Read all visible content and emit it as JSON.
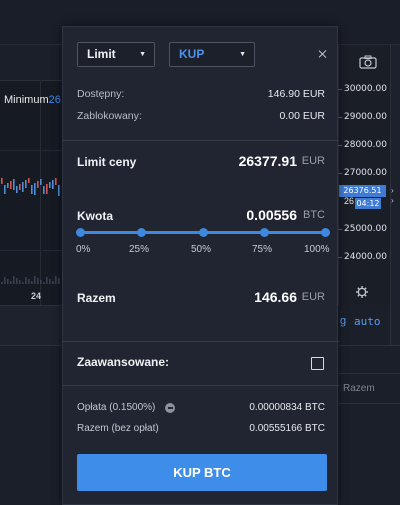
{
  "background": {
    "minimum_label": "Minimum",
    "minimum_value": "26",
    "x_tick": "24",
    "price_axis": [
      "30000.00",
      "29000.00",
      "28000.00",
      "27000.00",
      "26",
      "25000.00",
      "24000.00"
    ],
    "current_price": "26376.51",
    "countdown": "04:12",
    "auto_label": "auto",
    "g_label": "g",
    "razem_label": "Razem",
    "accent_color": "#3e7bd4"
  },
  "modal": {
    "order_type": "Limit",
    "side": "KUP",
    "available_label": "Dostępny:",
    "available_value": "146.90 EUR",
    "blocked_label": "Zablokowany:",
    "blocked_value": "0.00 EUR",
    "limit_label": "Limit ceny",
    "limit_value": "26377.91",
    "limit_unit": "EUR",
    "amount_label": "Kwota",
    "amount_value": "0.00556",
    "amount_unit": "BTC",
    "slider": {
      "fill_fraction": 1.0,
      "marks": [
        "0%",
        "25%",
        "50%",
        "75%",
        "100%"
      ]
    },
    "total_label": "Razem",
    "total_value": "146.66",
    "total_unit": "EUR",
    "advanced_label": "Zaawansowane:",
    "advanced_checked": false,
    "fee_label": "Opłata (0.1500%)",
    "fee_value": "0.00000834 BTC",
    "net_label": "Razem (bez opłat)",
    "net_value": "0.00555166 BTC",
    "buy_button": "KUP BTC",
    "button_color": "#3e8de8",
    "side_color": "#4d93ea"
  }
}
